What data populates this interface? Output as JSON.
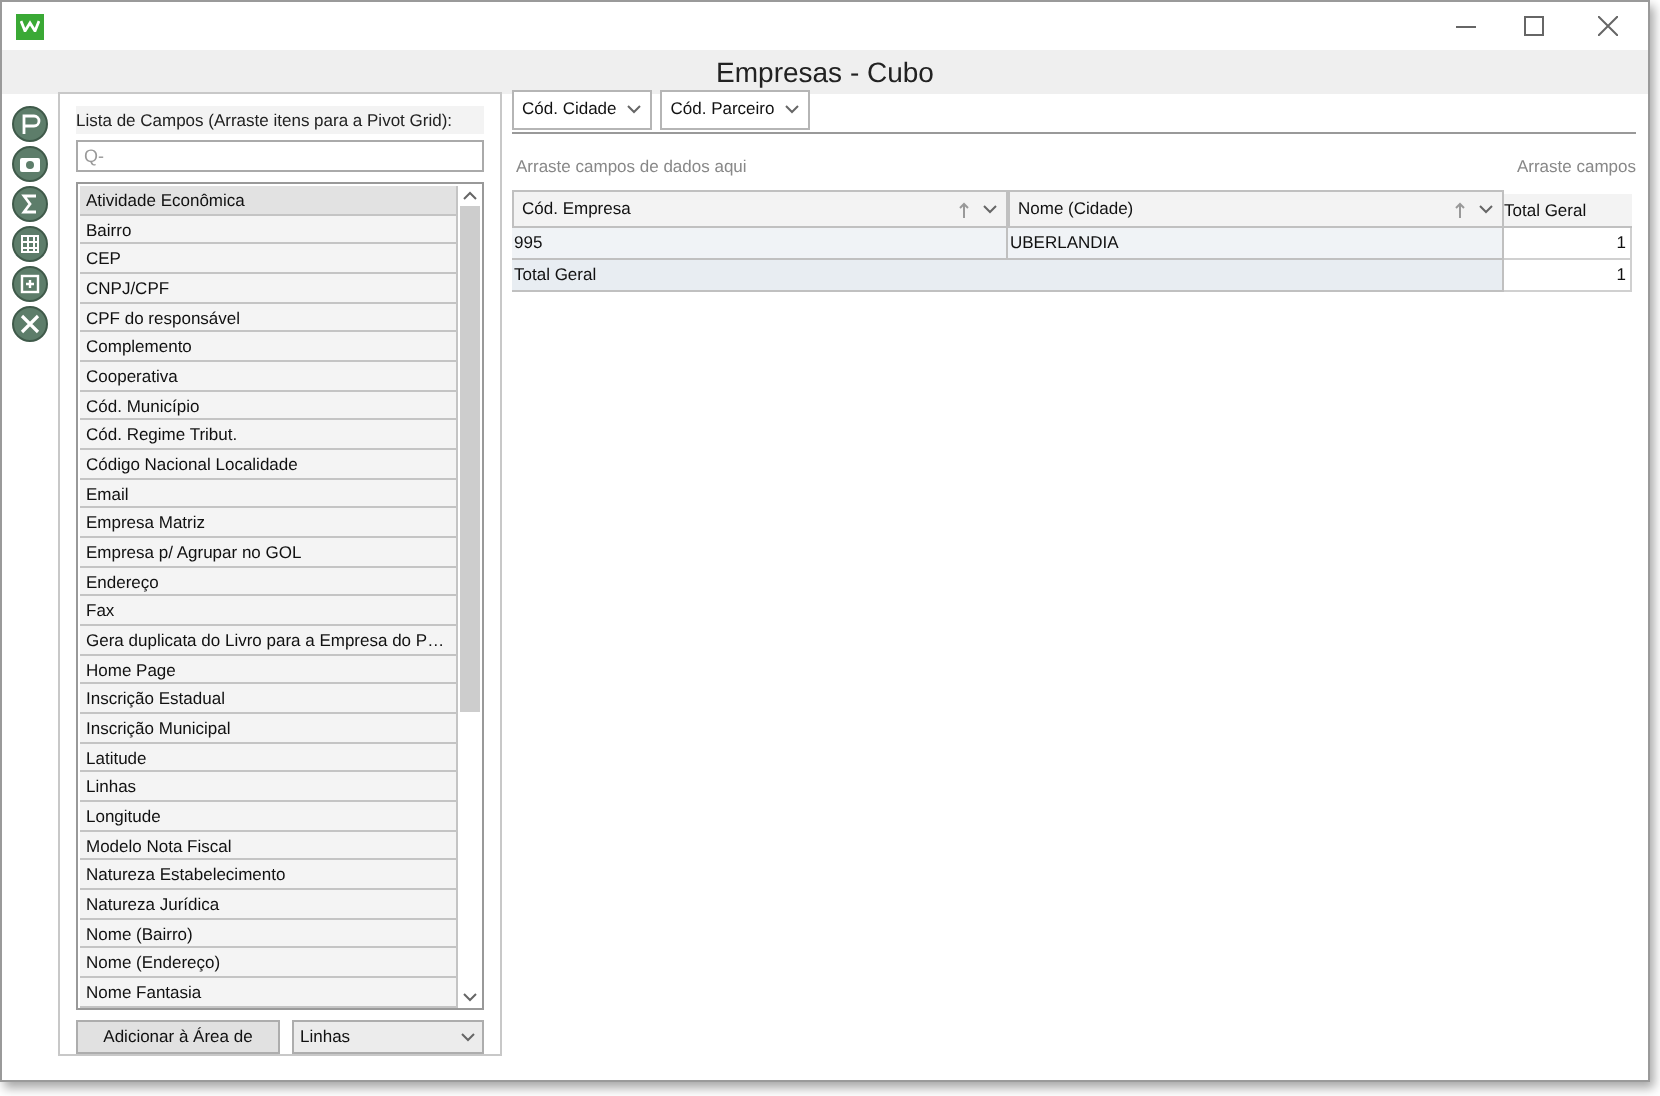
{
  "window": {
    "title": "Empresas - Cubo"
  },
  "side_toolbar": [
    {
      "kind": "report"
    },
    {
      "kind": "camera"
    },
    {
      "kind": "sum"
    },
    {
      "kind": "grid"
    },
    {
      "kind": "export"
    },
    {
      "kind": "excel"
    }
  ],
  "field_list": {
    "label": "Lista de Campos (Arraste itens para a Pivot Grid):",
    "search": {
      "placeholder": "Q-"
    },
    "items": [
      {
        "label": "Atividade Econômica",
        "selected": true
      },
      {
        "label": "Bairro",
        "selected": false
      },
      {
        "label": "CEP",
        "selected": false
      },
      {
        "label": "CNPJ/CPF",
        "selected": false
      },
      {
        "label": "CPF do responsável",
        "selected": false
      },
      {
        "label": "Complemento",
        "selected": false
      },
      {
        "label": "Cooperativa",
        "selected": false
      },
      {
        "label": "Cód. Município",
        "selected": false
      },
      {
        "label": "Cód. Regime Tribut.",
        "selected": false
      },
      {
        "label": "Código Nacional Localidade",
        "selected": false
      },
      {
        "label": "Email",
        "selected": false
      },
      {
        "label": "Empresa Matriz",
        "selected": false
      },
      {
        "label": "Empresa p/ Agrupar no GOL",
        "selected": false
      },
      {
        "label": "Endereço",
        "selected": false
      },
      {
        "label": "Fax",
        "selected": false
      },
      {
        "label": "Gera duplicata do Livro para a Empresa do P…",
        "selected": false
      },
      {
        "label": "Home Page",
        "selected": false
      },
      {
        "label": "Inscrição Estadual",
        "selected": false
      },
      {
        "label": "Inscrição Municipal",
        "selected": false
      },
      {
        "label": "Latitude",
        "selected": false
      },
      {
        "label": "Linhas",
        "selected": false
      },
      {
        "label": "Longitude",
        "selected": false
      },
      {
        "label": "Modelo Nota Fiscal",
        "selected": false
      },
      {
        "label": "Natureza Estabelecimento",
        "selected": false
      },
      {
        "label": "Natureza Jurídica",
        "selected": false
      },
      {
        "label": "Nome (Bairro)",
        "selected": false
      },
      {
        "label": "Nome (Endereço)",
        "selected": false
      },
      {
        "label": "Nome Fantasia",
        "selected": false
      }
    ],
    "add_button": "Adicionar à Área de",
    "area_select": "Linhas"
  },
  "filter_fields": [
    "Cód. Cidade",
    "Cód. Parceiro"
  ],
  "data_area_hint": "Arraste campos de dados aqui",
  "column_area_hint": "Arraste campos",
  "row_headers": [
    "Cód. Empresa",
    "Nome (Cidade)"
  ],
  "total_header": "Total Geral",
  "rows": [
    {
      "cells": [
        "995",
        "UBERLANDIA"
      ],
      "total": "1"
    }
  ],
  "grand_total": {
    "label": "Total Geral",
    "value": "1"
  }
}
